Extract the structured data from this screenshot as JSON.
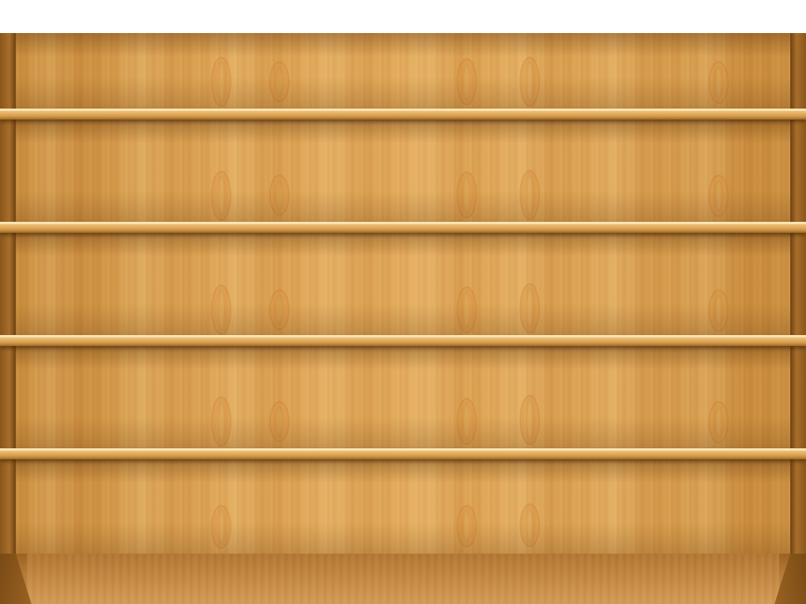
{
  "scene": {
    "description_name": "empty-wooden-bookshelf",
    "shelf_count": 5,
    "colors": {
      "back_panel": "#dba152",
      "shelf_top": "#f6d190",
      "shelf_edge": "#a06a25",
      "side_wall": "#8a561c",
      "floor": "#c48944",
      "background": "#ffffff"
    }
  }
}
